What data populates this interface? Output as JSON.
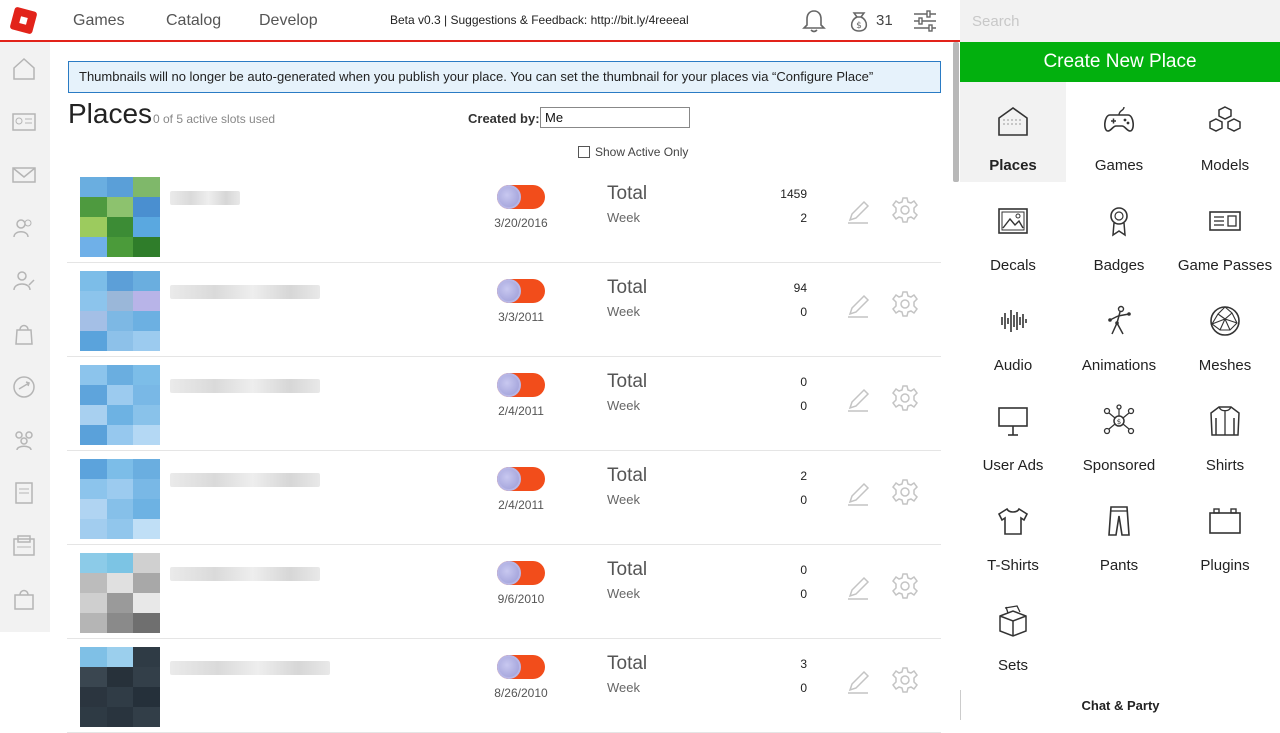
{
  "nav": {
    "games": "Games",
    "catalog": "Catalog",
    "develop": "Develop"
  },
  "beta_text": "Beta v0.3 | Suggestions & Feedback: http://bit.ly/4reeeal",
  "robux": "31",
  "search": {
    "placeholder": "Search"
  },
  "banner": "Thumbnails will no longer be auto-generated when you publish your place. You can set the thumbnail for your places via “Configure Place”",
  "page": {
    "title": "Places",
    "slots": "0 of 5 active slots used",
    "created_by_label": "Created by:",
    "created_by_value": "Me",
    "show_active_label": "Show Active Only"
  },
  "stat_labels": {
    "total": "Total",
    "week": "Week"
  },
  "places": [
    {
      "date": "3/20/2016",
      "total": "1459",
      "week": "2"
    },
    {
      "date": "3/3/2011",
      "total": "94",
      "week": "0"
    },
    {
      "date": "2/4/2011",
      "total": "0",
      "week": "0"
    },
    {
      "date": "2/4/2011",
      "total": "2",
      "week": "0"
    },
    {
      "date": "9/6/2010",
      "total": "0",
      "week": "0"
    },
    {
      "date": "8/26/2010",
      "total": "3",
      "week": "0"
    }
  ],
  "panel": {
    "create_label": "Create New Place",
    "tiles": [
      "Places",
      "Games",
      "Models",
      "Decals",
      "Badges",
      "Game Passes",
      "Audio",
      "Animations",
      "Meshes",
      "User Ads",
      "Sponsored",
      "Shirts",
      "T-Shirts",
      "Pants",
      "Plugins",
      "Sets"
    ],
    "chat_label": "Chat & Party"
  },
  "colors": {
    "accent_red": "#e2231a",
    "create_green": "#02b00e",
    "toggle_orange": "#f24d1b",
    "banner_border": "#2a7bc4"
  }
}
